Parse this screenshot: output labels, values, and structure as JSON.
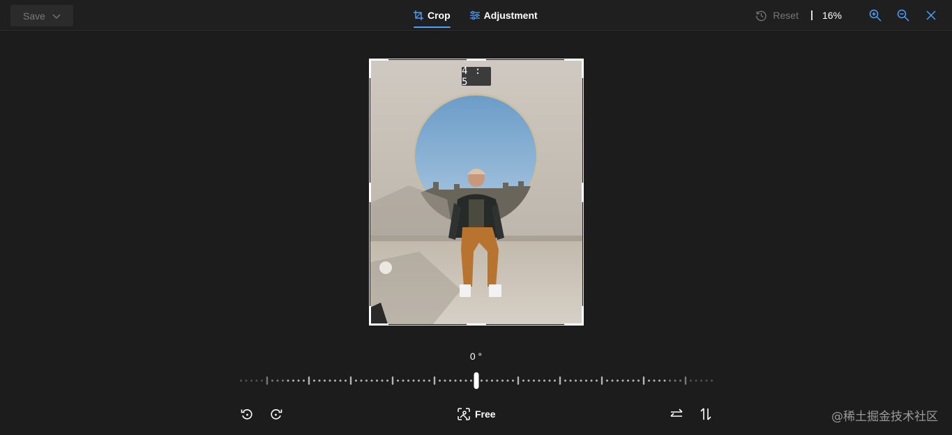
{
  "toolbar": {
    "save_label": "Save",
    "tabs": [
      {
        "label": "Crop",
        "icon": "crop-icon",
        "active": true
      },
      {
        "label": "Adjustment",
        "icon": "sliders-icon",
        "active": false
      }
    ],
    "reset_label": "Reset",
    "zoom_level": "16%",
    "icons": [
      "history-icon",
      "zoom-in-icon",
      "zoom-out-icon",
      "close-icon"
    ]
  },
  "crop": {
    "aspect_ratio_label": "4 : 5"
  },
  "rotation": {
    "angle_label": "0 °"
  },
  "bottom_bar": {
    "aspect_label": "Free",
    "icons": [
      "rotate-left-icon",
      "rotate-right-icon",
      "aspect-ratio-icon",
      "flip-horizontal-icon",
      "flip-vertical-icon"
    ]
  },
  "watermark": "@稀土掘金技术社区",
  "colors": {
    "background": "#1c1c1c",
    "accent": "#4ca0ff",
    "muted": "#777777"
  }
}
